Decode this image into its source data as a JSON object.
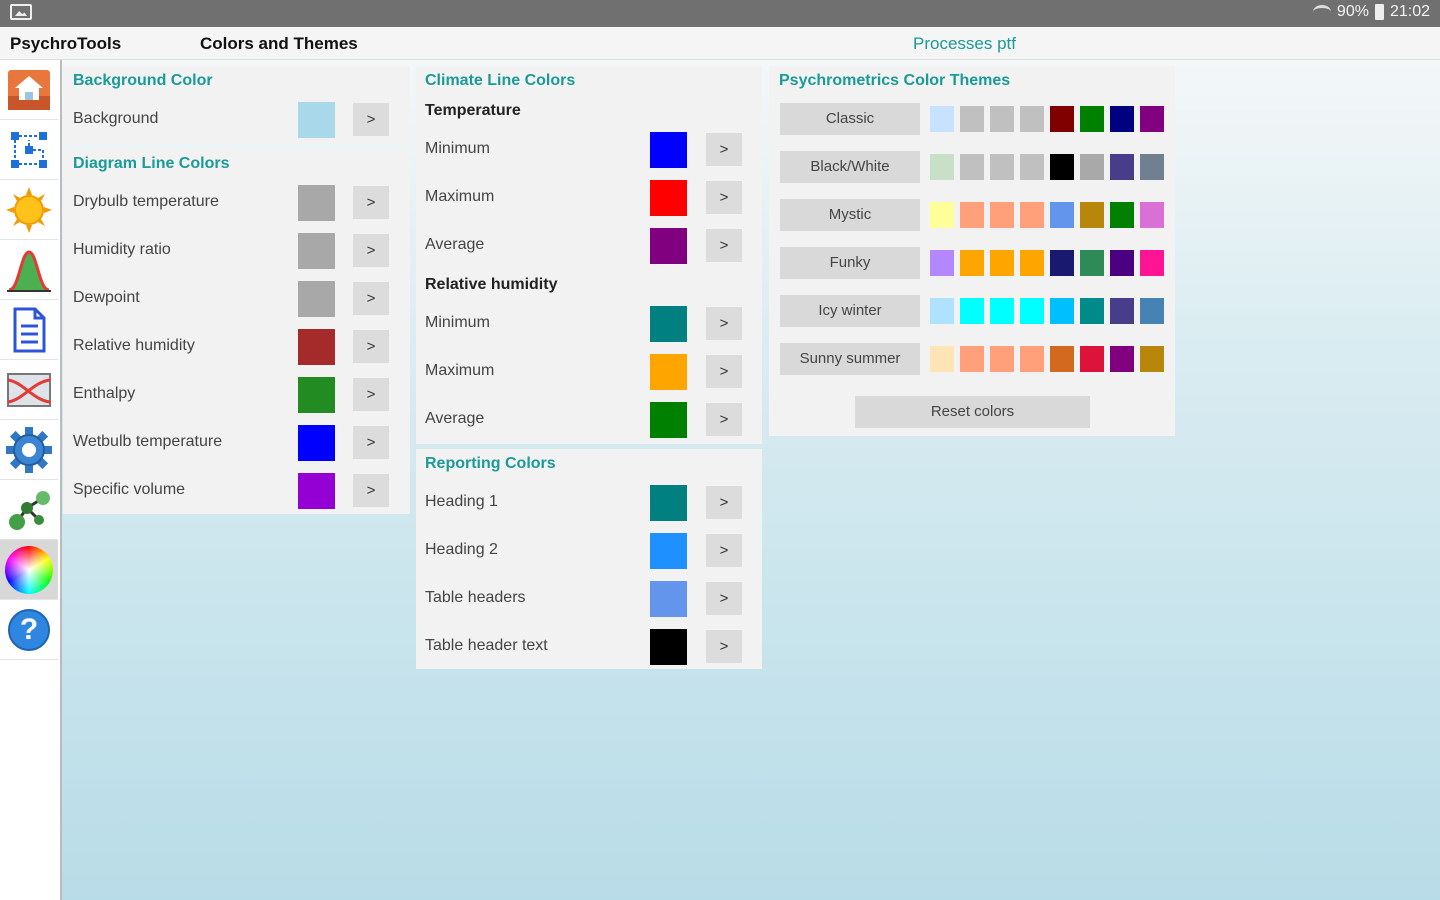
{
  "status": {
    "battery": "90%",
    "time": "21:02"
  },
  "appbar": {
    "app_name": "PsychroTools",
    "title": "Colors and Themes",
    "link": "Processes ptf"
  },
  "sidebar": [
    {
      "icon": "house-icon"
    },
    {
      "icon": "process-diagram-icon"
    },
    {
      "icon": "sun-icon"
    },
    {
      "icon": "distribution-chart-icon"
    },
    {
      "icon": "document-icon"
    },
    {
      "icon": "chart-cross-icon"
    },
    {
      "icon": "gear-icon"
    },
    {
      "icon": "molecule-icon"
    },
    {
      "icon": "color-wheel-icon",
      "active": true
    },
    {
      "icon": "help-icon"
    }
  ],
  "background_section": {
    "heading": "Background Color",
    "items": [
      {
        "label": "Background",
        "color": "#a9d8ea",
        "button": ">"
      }
    ]
  },
  "diagram_section": {
    "heading": "Diagram Line Colors",
    "items": [
      {
        "label": "Drybulb temperature",
        "color": "#a8a8a8",
        "button": ">"
      },
      {
        "label": "Humidity ratio",
        "color": "#a8a8a8",
        "button": ">"
      },
      {
        "label": "Dewpoint",
        "color": "#a8a8a8",
        "button": ">"
      },
      {
        "label": "Relative humidity",
        "color": "#a52a2a",
        "button": ">"
      },
      {
        "label": "Enthalpy",
        "color": "#228b22",
        "button": ">"
      },
      {
        "label": "Wetbulb temperature",
        "color": "#0000ff",
        "button": ">"
      },
      {
        "label": "Specific volume",
        "color": "#9400d3",
        "button": ">"
      }
    ]
  },
  "climate_section": {
    "heading": "Climate Line Colors",
    "temperature": {
      "heading": "Temperature",
      "items": [
        {
          "label": "Minimum",
          "color": "#0000ff",
          "button": ">"
        },
        {
          "label": "Maximum",
          "color": "#ff0000",
          "button": ">"
        },
        {
          "label": "Average",
          "color": "#800080",
          "button": ">"
        }
      ]
    },
    "humidity": {
      "heading": "Relative humidity",
      "items": [
        {
          "label": "Minimum",
          "color": "#008080",
          "button": ">"
        },
        {
          "label": "Maximum",
          "color": "#ffa500",
          "button": ">"
        },
        {
          "label": "Average",
          "color": "#008000",
          "button": ">"
        }
      ]
    }
  },
  "reporting_section": {
    "heading": "Reporting Colors",
    "items": [
      {
        "label": "Heading 1",
        "color": "#008080",
        "button": ">"
      },
      {
        "label": "Heading 2",
        "color": "#1e90ff",
        "button": ">"
      },
      {
        "label": "Table headers",
        "color": "#6495ed",
        "button": ">"
      },
      {
        "label": "Table header text",
        "color": "#000000",
        "button": ">"
      }
    ]
  },
  "themes_section": {
    "heading": "Psychrometrics Color Themes",
    "themes": [
      {
        "name": "Classic",
        "colors": [
          "#c6e2ff",
          "#c0c0c0",
          "#c0c0c0",
          "#c0c0c0",
          "#800000",
          "#008000",
          "#000080",
          "#800080"
        ]
      },
      {
        "name": "Black/White",
        "colors": [
          "#c8e0c8",
          "#c0c0c0",
          "#c0c0c0",
          "#c0c0c0",
          "#000000",
          "#a9a9a9",
          "#483d8b",
          "#708090"
        ]
      },
      {
        "name": "Mystic",
        "colors": [
          "#ffff99",
          "#ffa07a",
          "#ffa07a",
          "#ffa07a",
          "#6495ed",
          "#b8860b",
          "#008000",
          "#da70d6"
        ]
      },
      {
        "name": "Funky",
        "colors": [
          "#b388ff",
          "#ffa500",
          "#ffa500",
          "#ffa500",
          "#191970",
          "#2e8b57",
          "#4b0082",
          "#ff1493"
        ]
      },
      {
        "name": "Icy winter",
        "colors": [
          "#aee2ff",
          "#00ffff",
          "#00ffff",
          "#00ffff",
          "#00bfff",
          "#008b8b",
          "#483d8b",
          "#4682b4"
        ]
      },
      {
        "name": "Sunny summer",
        "colors": [
          "#ffe4b5",
          "#ffa07a",
          "#ffa07a",
          "#ffa07a",
          "#d2691e",
          "#dc143c",
          "#800080",
          "#b8860b"
        ]
      }
    ],
    "reset": "Reset colors"
  }
}
